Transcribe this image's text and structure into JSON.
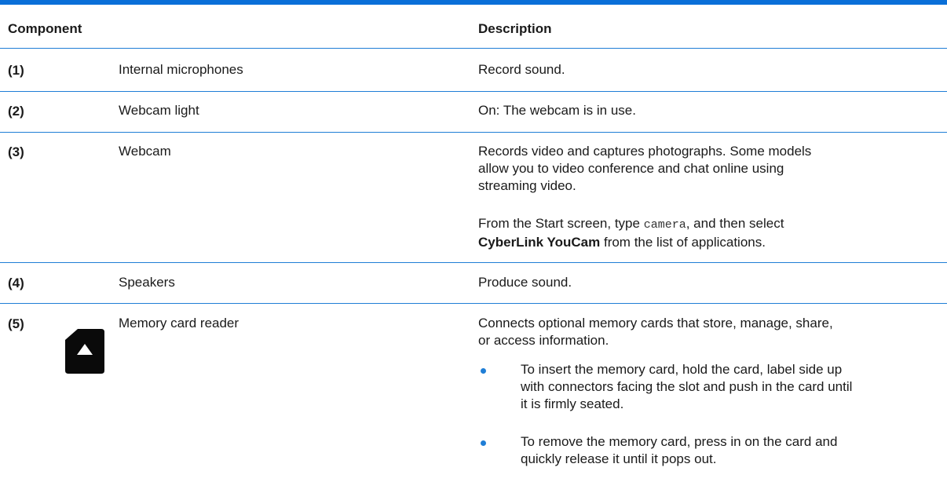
{
  "table": {
    "header": {
      "component": "Component",
      "description": "Description"
    },
    "rows": [
      {
        "num": "(1)",
        "name": "Internal microphones",
        "desc": "Record sound."
      },
      {
        "num": "(2)",
        "name": "Webcam light",
        "desc": "On: The webcam is in use."
      },
      {
        "num": "(3)",
        "name": "Webcam",
        "desc_lines": [
          "Records video and captures photographs. Some models",
          "allow you to video conference and chat online using",
          "streaming video."
        ],
        "note_line1_pre": "From the Start screen, type ",
        "note_code": "camera",
        "note_line1_post": ", and then select",
        "note_bold": "CyberLink YouCam",
        "note_line2_post": " from the list of applications."
      },
      {
        "num": "(4)",
        "name": "Speakers",
        "desc": "Produce sound."
      },
      {
        "num": "(5)",
        "name": "Memory card reader",
        "icon": "memory-card-icon",
        "desc_lines": [
          "Connects optional memory cards that store, manage, share,",
          "or access information."
        ],
        "bullets": [
          [
            "To insert the memory card, hold the card, label side up",
            "with connectors facing the slot and push in the card until",
            "it is firmly seated."
          ],
          [
            "To remove the memory card, press in on the card and",
            "quickly release it until it pops out."
          ]
        ]
      }
    ]
  },
  "colors": {
    "accent": "#1f7ed6",
    "top_bar": "#0a6fd8"
  }
}
